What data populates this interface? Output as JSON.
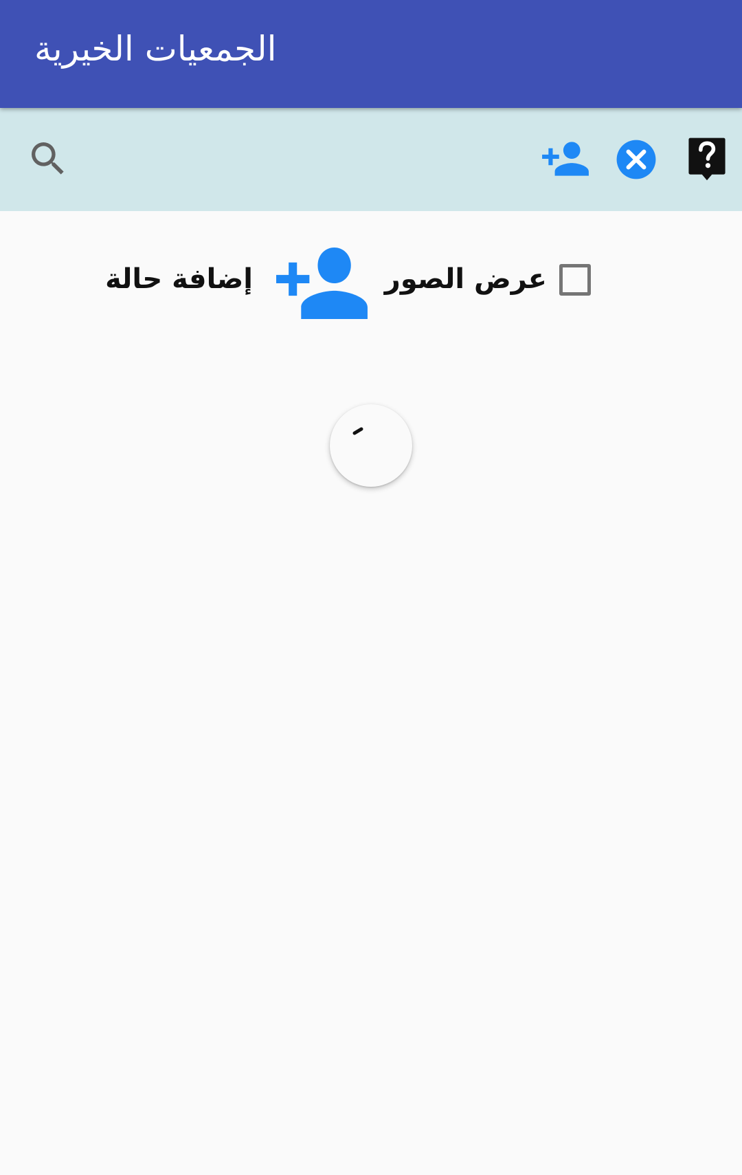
{
  "app_bar": {
    "title": "الجمعيات الخيرية",
    "background_color": "#3f51b5"
  },
  "toolbar": {
    "background_color": "#d0e7ea",
    "accent_color": "#1e88f5",
    "icons": [
      "search-icon",
      "add-person-icon",
      "close-circle-icon",
      "help-bubble-icon"
    ]
  },
  "controls": {
    "show_images_label": "عرض الصور",
    "show_images_checked": false,
    "add_case_label": "إضافة حالة",
    "add_case_icon": "add-person-icon"
  },
  "loading": {
    "visible": true
  }
}
